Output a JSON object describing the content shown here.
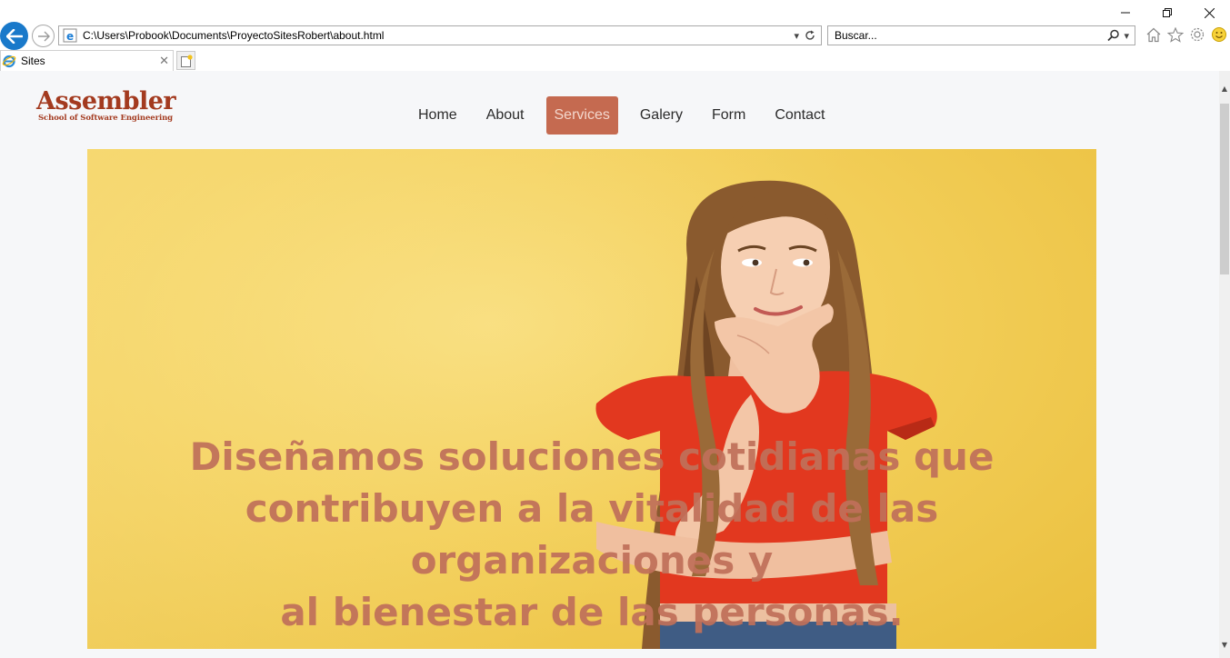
{
  "browser": {
    "address": "C:\\Users\\Probook\\Documents\\ProyectoSitesRobert\\about.html",
    "search_placeholder": "Buscar...",
    "tab_title": "Sites",
    "window_controls": {
      "minimize_icon": "minimize-icon",
      "restore_icon": "restore-icon",
      "close_icon": "close-icon"
    }
  },
  "site": {
    "logo": {
      "main": "Assembler",
      "sub": "School of Software Engineering"
    },
    "nav": [
      {
        "label": "Home",
        "active": false
      },
      {
        "label": "About",
        "active": false
      },
      {
        "label": "Services",
        "active": true
      },
      {
        "label": "Galery",
        "active": false
      },
      {
        "label": "Form",
        "active": false
      },
      {
        "label": "Contact",
        "active": false
      }
    ],
    "hero": {
      "heading_line1": "Diseñamos soluciones cotidianas que",
      "heading_line2": "contribuyen a la vitalidad de las organizaciones y",
      "heading_line3": "al bienestar de las personas."
    }
  },
  "colors": {
    "brand": "#a33a1f",
    "nav_active_bg": "#c56a50",
    "hero_text": "#c0705a",
    "hero_bg": "#f3cf5a",
    "shirt": "#e2381f"
  }
}
